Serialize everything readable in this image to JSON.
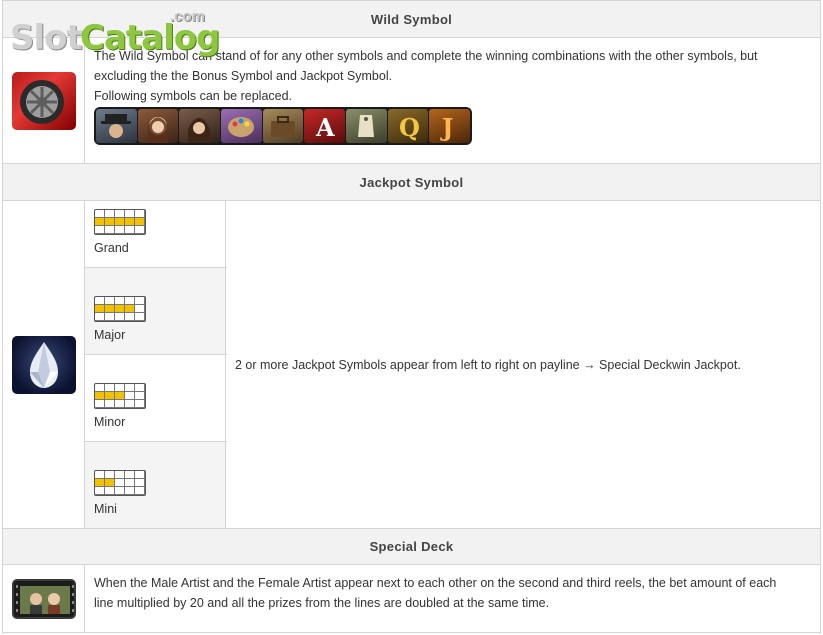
{
  "logo": {
    "slot": "Slot",
    "catalog": "Catalog",
    "com": ".com"
  },
  "wild": {
    "header": "Wild Symbol",
    "icon": "car-wheel-icon",
    "line1": "The Wild Symbol can stand of for any other symbols and complete the winning combinations with the other symbols, but",
    "line2": "excluding the the Bonus Symbol and Jackpot Symbol.",
    "line3": "Following symbols can be replaced.",
    "replaced_symbols": [
      "hat-man-symbol",
      "woman-symbol",
      "girl-symbol",
      "paint-palette-symbol",
      "bag-symbol",
      "ace-symbol",
      "tag-symbol",
      "queen-symbol",
      "jack-symbol"
    ]
  },
  "jackpot": {
    "header": "Jackpot Symbol",
    "icon": "diamond-icon",
    "levels": [
      {
        "label": "Grand",
        "filled": 5
      },
      {
        "label": "Major",
        "filled": 4
      },
      {
        "label": "Minor",
        "filled": 3
      },
      {
        "label": "Mini",
        "filled": 2
      }
    ],
    "description": "2 or more Jackpot Symbols appear from left to right on payline → Special Deckwin Jackpot."
  },
  "special": {
    "header": "Special Deck",
    "icon": "film-strip-icon",
    "line1": "When the Male Artist and the Female Artist appear next to each other on the second and third reels, the bet amount of each",
    "line2": "line multiplied by 20 and all the prizes from the lines are doubled at the same time."
  },
  "colors": {
    "header_bg": "#f2f2f2",
    "border": "#d4d4d4",
    "highlight": "#f2c200",
    "logo_green": "#8dc63f"
  }
}
